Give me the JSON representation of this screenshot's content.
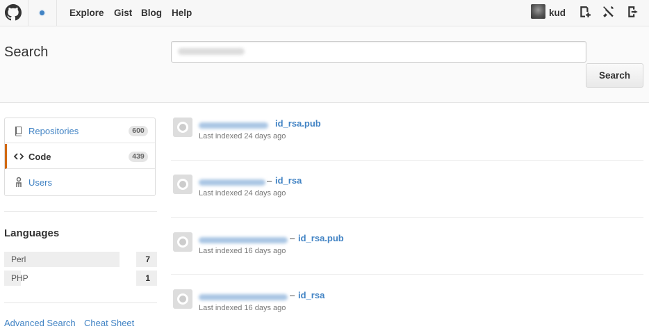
{
  "nav": {
    "links": [
      "Explore",
      "Gist",
      "Blog",
      "Help"
    ],
    "username": "kud"
  },
  "search": {
    "title": "Search",
    "button_label": "Search"
  },
  "filters": [
    {
      "label": "Repositories",
      "count": "600",
      "icon": "book-icon",
      "selected": false
    },
    {
      "label": "Code",
      "count": "439",
      "icon": "code-icon",
      "selected": true
    },
    {
      "label": "Users",
      "icon": "person-icon",
      "selected": false
    }
  ],
  "languages": {
    "title": "Languages",
    "items": [
      {
        "name": "Perl",
        "count": "7",
        "share": 0.875
      },
      {
        "name": "PHP",
        "count": "1",
        "share": 0.125
      }
    ]
  },
  "footer_links": [
    "Advanced Search",
    "Cheat Sheet"
  ],
  "results": [
    {
      "separator": "",
      "file": "id_rsa.pub",
      "meta": "Last indexed 24 days ago"
    },
    {
      "separator": "–",
      "file": "id_rsa",
      "meta": "Last indexed 24 days ago"
    },
    {
      "separator": "–",
      "file": "id_rsa.pub",
      "meta": "Last indexed 16 days ago"
    },
    {
      "separator": "–",
      "file": "id_rsa",
      "meta": "Last indexed 16 days ago"
    }
  ],
  "colors": {
    "link": "#4183c4",
    "selected_accent": "#d26911"
  }
}
